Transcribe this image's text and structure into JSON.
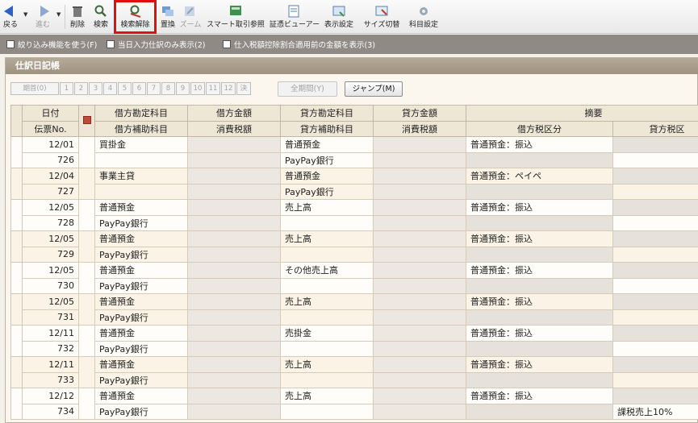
{
  "toolbar": {
    "back": "戻る",
    "forward": "進む",
    "delete": "削除",
    "search": "検索",
    "clear_search": "検索解除",
    "replace": "置換",
    "zoom": "ズーム",
    "smart": "スマート取引参照",
    "viewer": "証憑ビューアー",
    "display": "表示設定",
    "size": "サイズ切替",
    "account": "科目設定"
  },
  "options": {
    "filter": "絞り込み機能を使う(F)",
    "today_only": "当日入力仕訳のみ表示(2)",
    "tax_before": "仕入税額控除割合適用前の金額を表示(3)"
  },
  "panel": {
    "title": "仕訳日記帳",
    "period_label": "期首(0)",
    "months": [
      "1",
      "2",
      "3",
      "4",
      "5",
      "6",
      "7",
      "8",
      "9",
      "10",
      "11",
      "12",
      "決"
    ],
    "all_period": "全期間(Y)",
    "jump": "ジャンプ(M)"
  },
  "table": {
    "head1": [
      "日付",
      "借方勘定科目",
      "借方金額",
      "貸方勘定科目",
      "貸方金額",
      "摘要"
    ],
    "head2": [
      "伝票No.",
      "借方補助科目",
      "消費税額",
      "貸方補助科目",
      "消費税額",
      "借方税区分",
      "貸方税区"
    ],
    "rows": [
      {
        "date": "12/01",
        "no": "726",
        "debit": "買掛金",
        "debit_sub": "",
        "credit": "普通預金",
        "credit_sub": "PayPay銀行",
        "memo": "普通預金：振込",
        "tax2": ""
      },
      {
        "date": "12/04",
        "no": "727",
        "debit": "事業主貸",
        "debit_sub": "",
        "credit": "普通預金",
        "credit_sub": "PayPay銀行",
        "memo": "普通預金：ペイペ",
        "tax2": ""
      },
      {
        "date": "12/05",
        "no": "728",
        "debit": "普通預金",
        "debit_sub": "PayPay銀行",
        "credit": "売上高",
        "credit_sub": "",
        "memo": "普通預金：振込",
        "tax2": ""
      },
      {
        "date": "12/05",
        "no": "729",
        "debit": "普通預金",
        "debit_sub": "PayPay銀行",
        "credit": "売上高",
        "credit_sub": "",
        "memo": "普通預金：振込",
        "tax2": ""
      },
      {
        "date": "12/05",
        "no": "730",
        "debit": "普通預金",
        "debit_sub": "PayPay銀行",
        "credit": "その他売上高",
        "credit_sub": "",
        "memo": "普通預金：振込",
        "tax2": ""
      },
      {
        "date": "12/05",
        "no": "731",
        "debit": "普通預金",
        "debit_sub": "PayPay銀行",
        "credit": "売上高",
        "credit_sub": "",
        "memo": "普通預金：振込",
        "tax2": ""
      },
      {
        "date": "12/11",
        "no": "732",
        "debit": "普通預金",
        "debit_sub": "PayPay銀行",
        "credit": "売掛金",
        "credit_sub": "",
        "memo": "普通預金：振込",
        "tax2": ""
      },
      {
        "date": "12/11",
        "no": "733",
        "debit": "普通預金",
        "debit_sub": "PayPay銀行",
        "credit": "売上高",
        "credit_sub": "",
        "memo": "普通預金：振込",
        "tax2": ""
      },
      {
        "date": "12/12",
        "no": "734",
        "debit": "普通預金",
        "debit_sub": "PayPay銀行",
        "credit": "売上高",
        "credit_sub": "",
        "memo": "普通預金：振込",
        "tax2": "課税売上10%"
      }
    ]
  },
  "colors": {
    "highlight": "#e01010",
    "options_bar": "#8f8b84",
    "panel_title": "#a89d89"
  },
  "icons": [
    "back-arrow-icon",
    "forward-arrow-icon",
    "trash-icon",
    "magnifier-icon",
    "clear-search-icon",
    "replace-icon",
    "zoom-icon",
    "smart-reference-icon",
    "viewer-icon",
    "display-settings-icon",
    "size-toggle-icon",
    "account-settings-icon",
    "book-icon"
  ]
}
